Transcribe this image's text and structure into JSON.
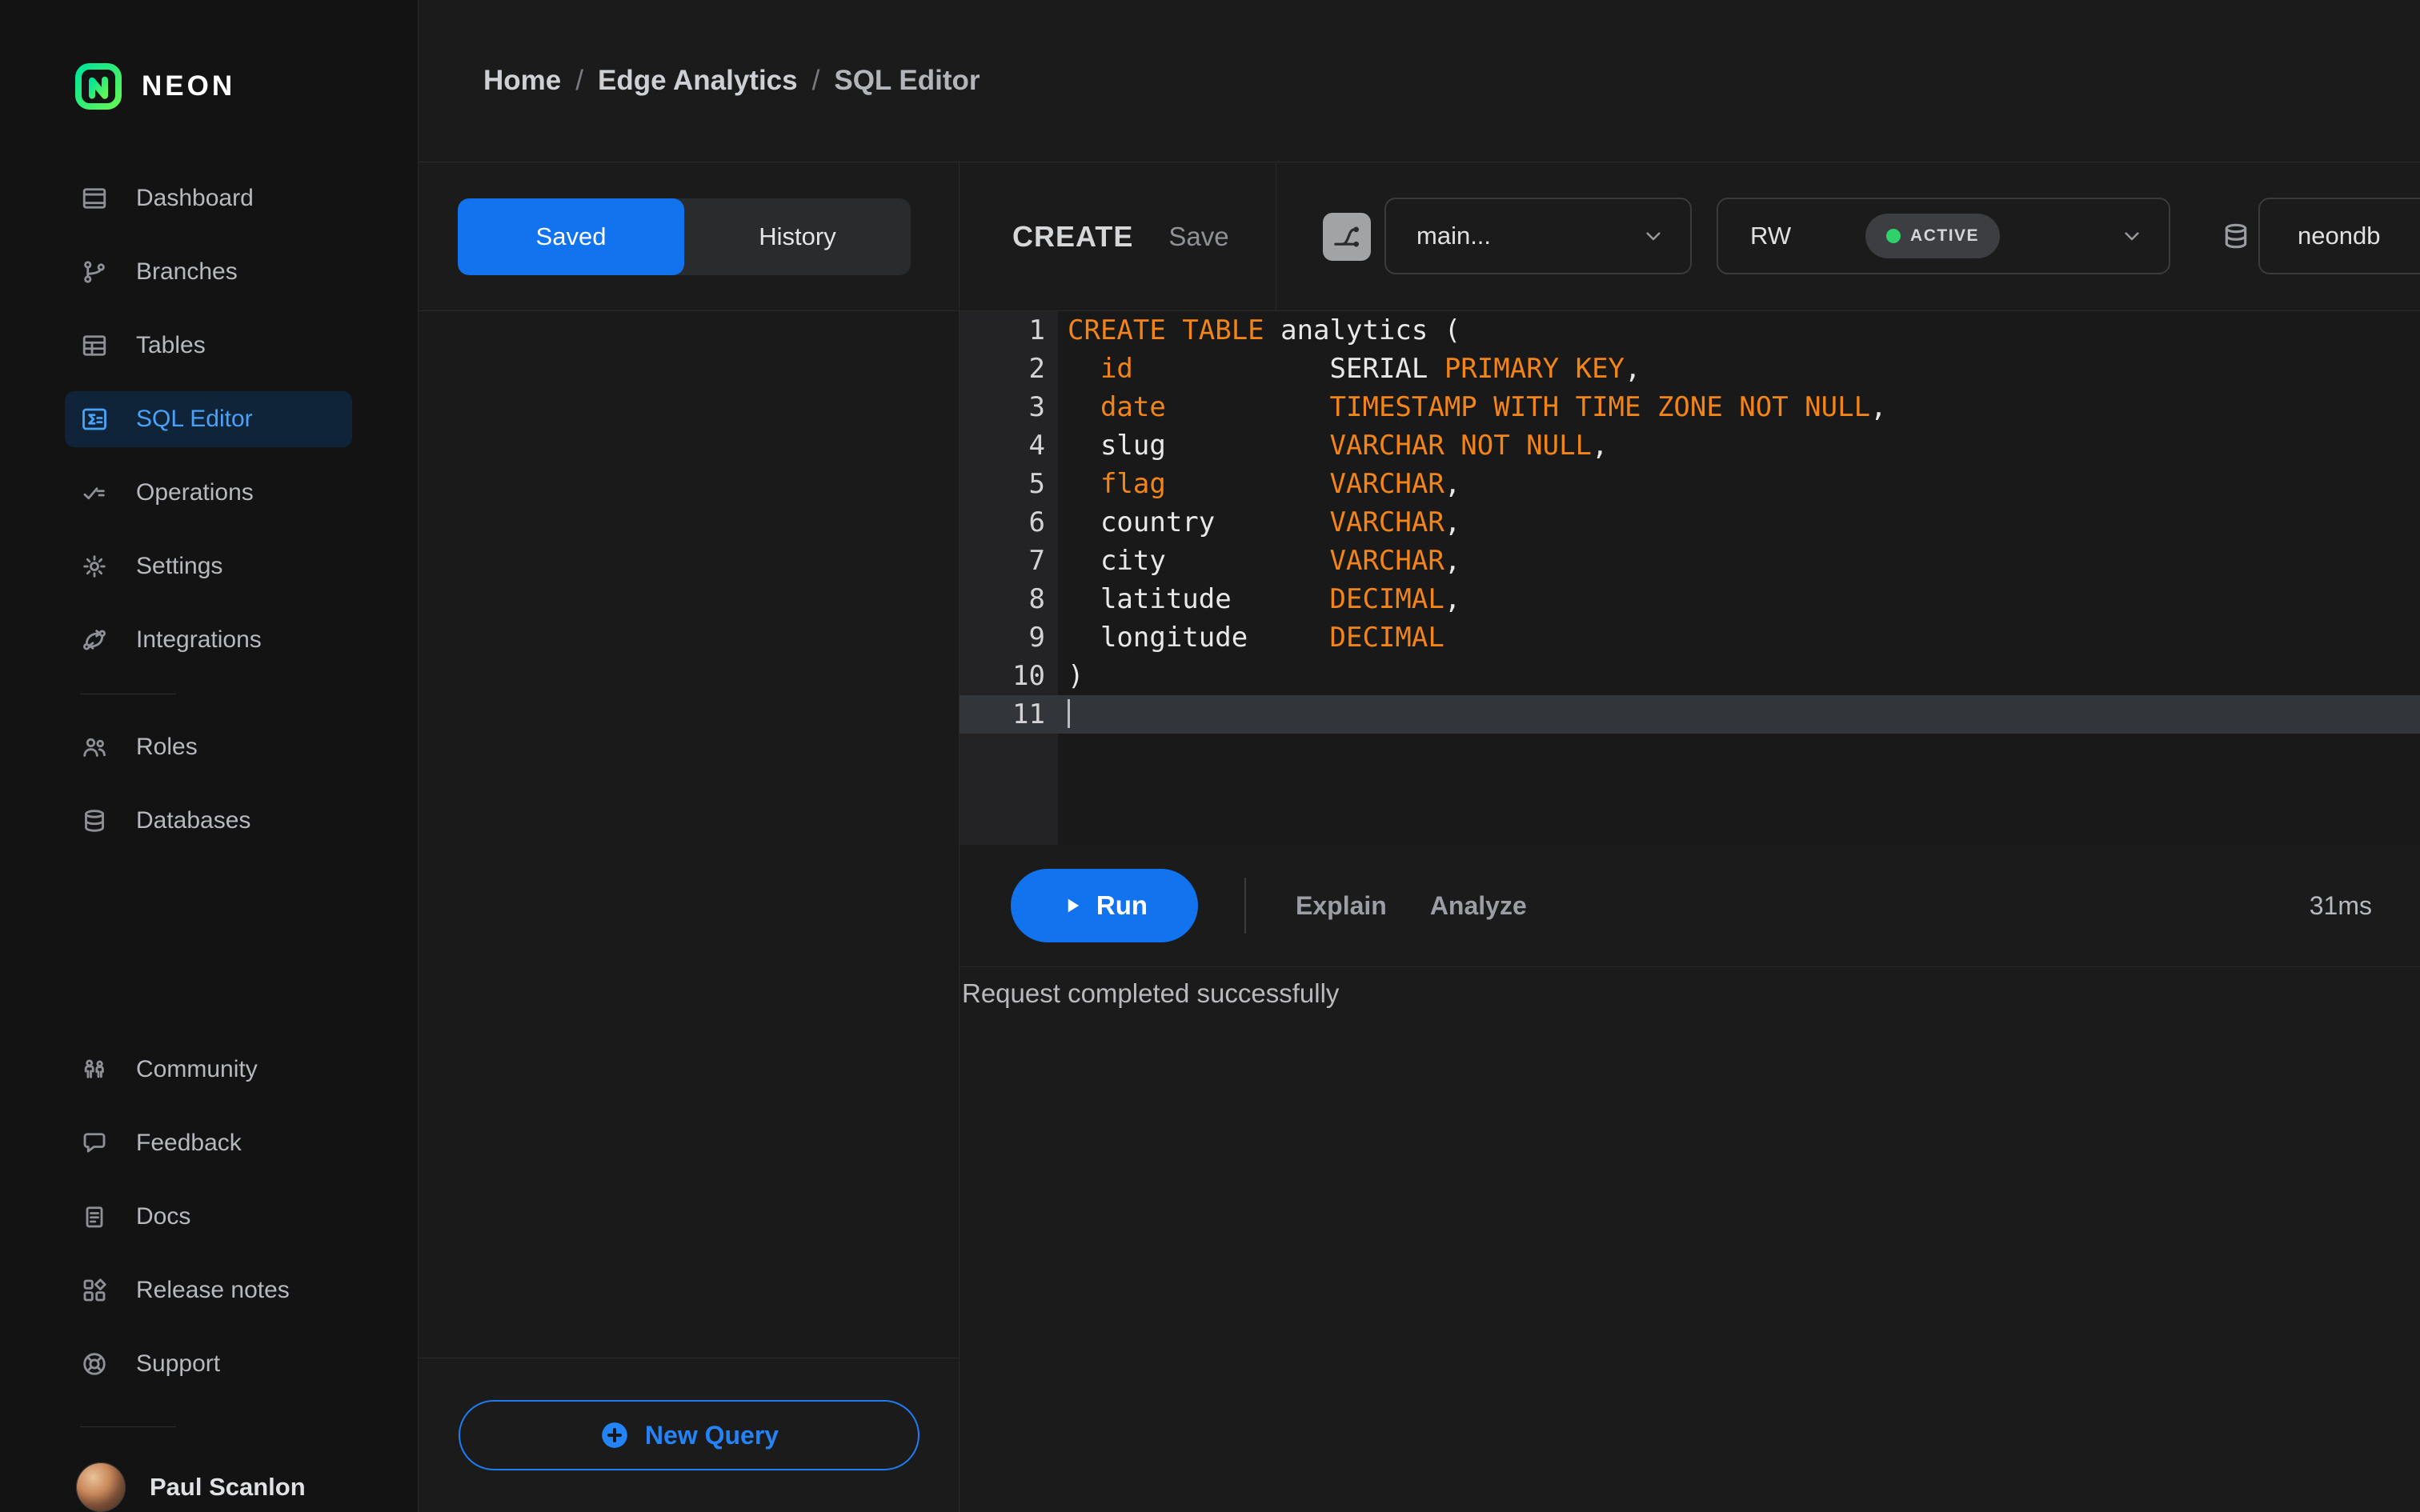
{
  "brand": {
    "name": "NEON"
  },
  "colors": {
    "accent_blue": "#1173ee",
    "active_item_blue": "#4aa2f8",
    "keyword_orange": "#f28418",
    "status_green": "#2fd26a",
    "logo_green_start": "#00e599",
    "logo_green_end": "#62f655"
  },
  "sidebar": {
    "main_items": [
      {
        "id": "dashboard",
        "label": "Dashboard",
        "icon": "dashboard-icon"
      },
      {
        "id": "branches",
        "label": "Branches",
        "icon": "branches-icon"
      },
      {
        "id": "tables",
        "label": "Tables",
        "icon": "tables-icon"
      },
      {
        "id": "sql-editor",
        "label": "SQL Editor",
        "icon": "sql-editor-icon",
        "active": true
      },
      {
        "id": "operations",
        "label": "Operations",
        "icon": "operations-icon"
      },
      {
        "id": "settings",
        "label": "Settings",
        "icon": "settings-icon"
      },
      {
        "id": "integrations",
        "label": "Integrations",
        "icon": "integrations-icon"
      }
    ],
    "secondary_items": [
      {
        "id": "roles",
        "label": "Roles",
        "icon": "roles-icon"
      },
      {
        "id": "databases",
        "label": "Databases",
        "icon": "databases-icon"
      }
    ],
    "footer_items": [
      {
        "id": "community",
        "label": "Community",
        "icon": "community-icon"
      },
      {
        "id": "feedback",
        "label": "Feedback",
        "icon": "feedback-icon"
      },
      {
        "id": "docs",
        "label": "Docs",
        "icon": "docs-icon"
      },
      {
        "id": "release-notes",
        "label": "Release notes",
        "icon": "release-notes-icon"
      },
      {
        "id": "support",
        "label": "Support",
        "icon": "support-icon"
      }
    ],
    "user": {
      "name": "Paul Scanlon"
    }
  },
  "breadcrumb": {
    "items": [
      "Home",
      "Edge Analytics",
      "SQL Editor"
    ],
    "separator": "/"
  },
  "left_panel": {
    "tabs": [
      {
        "label": "Saved",
        "active": true
      },
      {
        "label": "History",
        "active": false
      }
    ],
    "new_query_label": "New Query"
  },
  "editor": {
    "title": "CREATE",
    "save_label": "Save",
    "branch_select": {
      "value": "main..."
    },
    "compute_select": {
      "value": "RW",
      "status": "ACTIVE"
    },
    "database_select": {
      "value": "neondb"
    },
    "run_label": "Run",
    "explain_label": "Explain",
    "analyze_label": "Analyze",
    "duration": "31ms",
    "status_message": "Request completed successfully",
    "code": {
      "active_line": 11,
      "lines": [
        {
          "tokens": [
            [
              "k",
              "CREATE TABLE"
            ],
            [
              "p",
              " analytics ("
            ]
          ]
        },
        {
          "tokens": [
            [
              "p",
              "  "
            ],
            [
              "k",
              "id"
            ],
            [
              "p",
              "            SERIAL "
            ],
            [
              "k",
              "PRIMARY KEY"
            ],
            [
              "p",
              ","
            ]
          ]
        },
        {
          "tokens": [
            [
              "p",
              "  "
            ],
            [
              "k",
              "date"
            ],
            [
              "p",
              "          "
            ],
            [
              "k",
              "TIMESTAMP WITH TIME ZONE NOT NULL"
            ],
            [
              "p",
              ","
            ]
          ]
        },
        {
          "tokens": [
            [
              "p",
              "  slug          "
            ],
            [
              "k",
              "VARCHAR NOT NULL"
            ],
            [
              "p",
              ","
            ]
          ]
        },
        {
          "tokens": [
            [
              "p",
              "  "
            ],
            [
              "k",
              "flag"
            ],
            [
              "p",
              "          "
            ],
            [
              "k",
              "VARCHAR"
            ],
            [
              "p",
              ","
            ]
          ]
        },
        {
          "tokens": [
            [
              "p",
              "  country       "
            ],
            [
              "k",
              "VARCHAR"
            ],
            [
              "p",
              ","
            ]
          ]
        },
        {
          "tokens": [
            [
              "p",
              "  city          "
            ],
            [
              "k",
              "VARCHAR"
            ],
            [
              "p",
              ","
            ]
          ]
        },
        {
          "tokens": [
            [
              "p",
              "  latitude      "
            ],
            [
              "k",
              "DECIMAL"
            ],
            [
              "p",
              ","
            ]
          ]
        },
        {
          "tokens": [
            [
              "p",
              "  longitude     "
            ],
            [
              "k",
              "DECIMAL"
            ]
          ]
        },
        {
          "tokens": [
            [
              "p",
              ")"
            ]
          ]
        },
        {
          "tokens": []
        }
      ]
    }
  }
}
